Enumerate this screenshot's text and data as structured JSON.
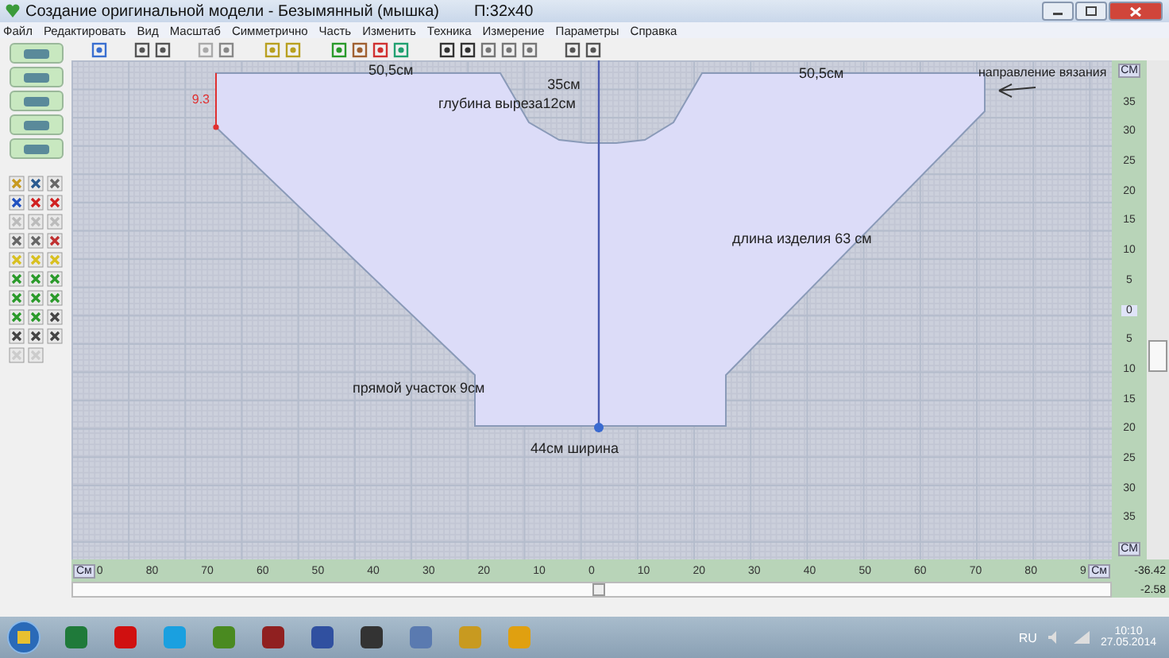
{
  "window": {
    "title": "Создание оригинальной модели - Безымянный (мышка)",
    "grid_size": "П:32х40"
  },
  "menu": [
    "Файл",
    "Редактировать",
    "Вид",
    "Масштаб",
    "Симметрично",
    "Часть",
    "Изменить",
    "Техника",
    "Измерение",
    "Параметры",
    "Справка"
  ],
  "canvas": {
    "labels": [
      "50,5см",
      "35см",
      "50,5см",
      "глубина выреза12см",
      "направление вязания",
      "длина изделия 63 см",
      "прямой участок 9см",
      "44см ширина"
    ],
    "marker": "9.3"
  },
  "vertical_ruler": {
    "unit_top": "СМ",
    "ticks": [
      "35",
      "30",
      "25",
      "20",
      "15",
      "10",
      "5",
      "0",
      "5",
      "10",
      "15",
      "20",
      "25",
      "30",
      "35"
    ],
    "unit_bottom": "СМ"
  },
  "horizontal_ruler": {
    "unit_left": "См",
    "ticks": [
      "0",
      "80",
      "70",
      "60",
      "50",
      "40",
      "30",
      "20",
      "10",
      "0",
      "10",
      "20",
      "30",
      "40",
      "50",
      "60",
      "70",
      "80",
      "9"
    ],
    "unit_right": "См"
  },
  "readouts": [
    "-36.42",
    "-2.58"
  ],
  "taskbar": {
    "language": "RU",
    "time": "10:10",
    "date": "27.05.2014"
  }
}
